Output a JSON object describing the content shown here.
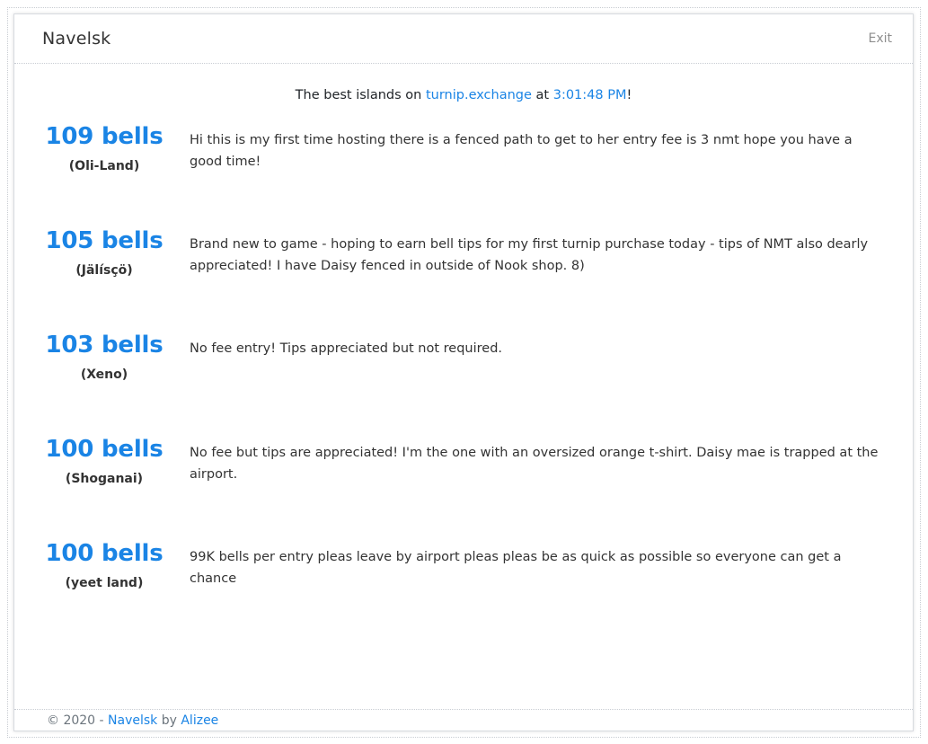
{
  "app": {
    "brand": "Navelsk",
    "exit_label": "Exit"
  },
  "headline": {
    "prefix": "The best islands on ",
    "site_link": "turnip.exchange",
    "middle": " at ",
    "time": "3:01:48 PM",
    "suffix": "!"
  },
  "islands": [
    {
      "price": "109 bells",
      "name": "(Oli-Land)",
      "description": "Hi this is my first time hosting there is a fenced path to get to her entry fee is 3 nmt hope you have a good time!"
    },
    {
      "price": "105 bells",
      "name": "(Jälísçö)",
      "description": "Brand new to game - hoping to earn bell tips for my first turnip purchase today - tips of NMT also dearly appreciated! I have Daisy fenced in outside of Nook shop. 8)"
    },
    {
      "price": "103 bells",
      "name": "(Xeno)",
      "description": "No fee entry! Tips appreciated but not required."
    },
    {
      "price": "100 bells",
      "name": "(Shoganai)",
      "description": "No fee but tips are appreciated! I'm the one with an oversized orange t-shirt. Daisy mae is trapped at the airport."
    },
    {
      "price": "100 bells",
      "name": "(yeet land)",
      "description": "99K bells per entry pleas leave by airport pleas pleas be as quick as possible so everyone can get a chance"
    }
  ],
  "footer": {
    "copyright": "© 2020 - ",
    "app_link": "Navelsk",
    "by": " by ",
    "author_link": "Alizee"
  },
  "colors": {
    "accent": "#1a84e5",
    "text": "#212529",
    "muted": "#8e8e8e"
  }
}
